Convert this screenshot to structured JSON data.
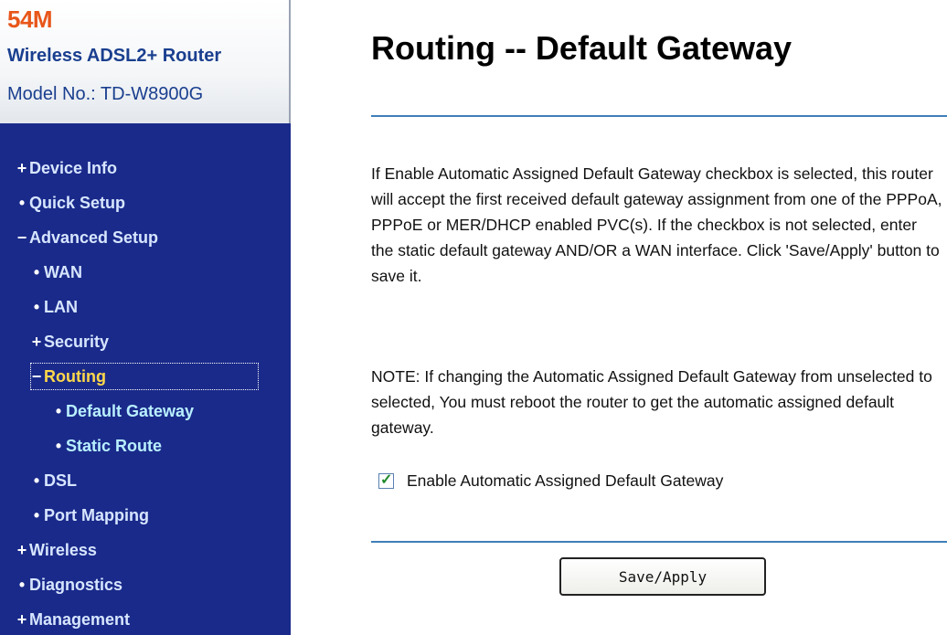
{
  "brand": {
    "line1": "54M",
    "line2": "Wireless ADSL2+ Router",
    "model_prefix": "Model No.: ",
    "model_value": "TD-W8900G"
  },
  "nav": {
    "items": [
      {
        "marker": "+",
        "label": "Device Info"
      },
      {
        "marker": "•",
        "label": "Quick Setup"
      },
      {
        "marker": "−",
        "label": "Advanced Setup"
      },
      {
        "marker": "•",
        "label": "WAN"
      },
      {
        "marker": "•",
        "label": "LAN"
      },
      {
        "marker": "+",
        "label": "Security"
      },
      {
        "marker": "−",
        "label": "Routing"
      },
      {
        "marker": "•",
        "label": "Default Gateway"
      },
      {
        "marker": "•",
        "label": "Static Route"
      },
      {
        "marker": "•",
        "label": "DSL"
      },
      {
        "marker": "•",
        "label": "Port Mapping"
      },
      {
        "marker": "+",
        "label": "Wireless"
      },
      {
        "marker": "•",
        "label": "Diagnostics"
      },
      {
        "marker": "+",
        "label": "Management"
      }
    ]
  },
  "main": {
    "title": "Routing -- Default Gateway",
    "paragraph1": "If Enable Automatic Assigned Default Gateway checkbox is selected, this router will accept the first received default gateway assignment from one of the PPPoA, PPPoE or MER/DHCP enabled PVC(s). If the checkbox is not selected, enter the static default gateway AND/OR a WAN interface. Click 'Save/Apply' button to save it.",
    "paragraph2": "NOTE: If changing the Automatic Assigned Default Gateway from unselected to selected, You must reboot the router to get the automatic assigned default gateway.",
    "checkbox_label": "Enable Automatic Assigned Default Gateway",
    "checkbox_checked": true,
    "save_label": "Save/Apply"
  },
  "colors": {
    "sidebar_bg": "#1a2a8a",
    "brand_orange": "#e8561a",
    "brand_blue": "#1a3f8f",
    "rule_blue": "#3f7fb7",
    "active_nav": "#ffd84a"
  }
}
